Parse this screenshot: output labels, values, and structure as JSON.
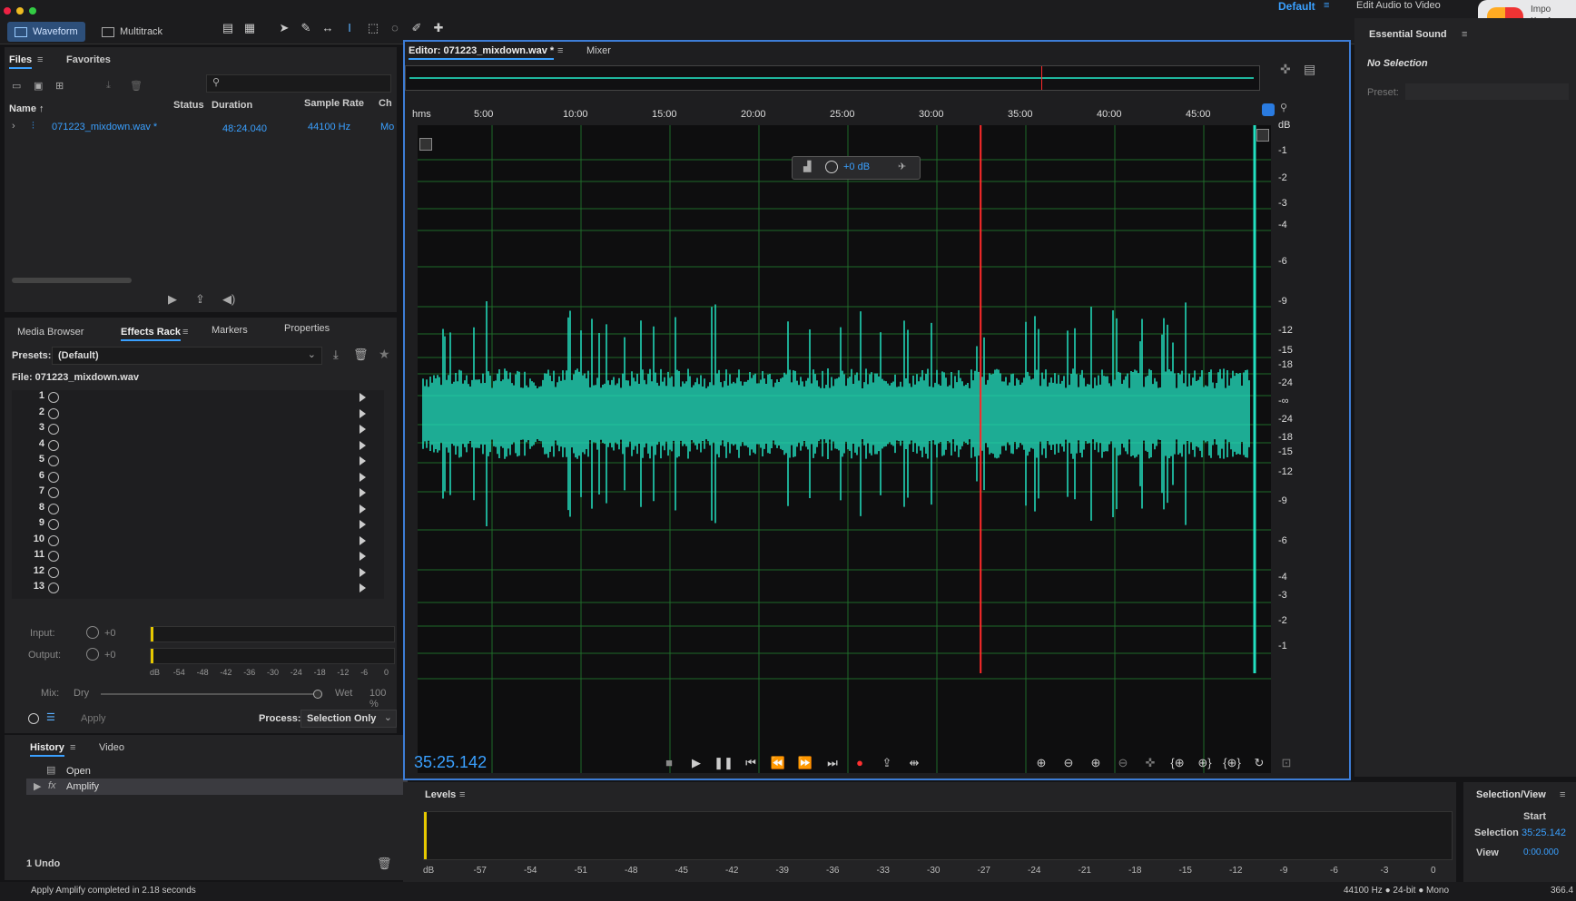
{
  "workspace": {
    "name": "Default",
    "edit_audio_label": "Edit Audio to Video",
    "notif_text": "Impo KeyAc KeyAc you a"
  },
  "tabs": {
    "waveform": "Waveform",
    "multitrack": "Multitrack"
  },
  "files_panel": {
    "tabs": [
      "Files",
      "Favorites"
    ],
    "columns": {
      "name": "Name",
      "status": "Status",
      "duration": "Duration",
      "sample_rate": "Sample Rate",
      "channels": "Ch"
    },
    "files": [
      {
        "name": "071223_mixdown.wav *",
        "duration": "48:24.040",
        "sample_rate": "44100 Hz",
        "channels": "Mo"
      }
    ]
  },
  "effects_panel": {
    "tabs": [
      "Media Browser",
      "Effects Rack",
      "Markers",
      "Properties"
    ],
    "presets_label": "Presets:",
    "preset_value": "(Default)",
    "file_label": "File: 071223_mixdown.wav",
    "slots": [
      "1",
      "2",
      "3",
      "4",
      "5",
      "6",
      "7",
      "8",
      "9",
      "10",
      "11",
      "12",
      "13"
    ],
    "input_label": "Input:",
    "input_value": "+0",
    "output_label": "Output:",
    "output_value": "+0",
    "meter_ticks": [
      "dB",
      "-54",
      "-48",
      "-42",
      "-36",
      "-30",
      "-24",
      "-18",
      "-12",
      "-6",
      "0"
    ],
    "mix_label": "Mix:",
    "dry_label": "Dry",
    "wet_label": "Wet",
    "wet_value": "100 %",
    "apply_label": "Apply",
    "process_label": "Process:",
    "process_value": "Selection Only"
  },
  "history_panel": {
    "tabs": [
      "History",
      "Video"
    ],
    "items": [
      "Open",
      "Amplify"
    ],
    "undo_label": "1 Undo"
  },
  "status_message": "Apply Amplify completed in 2.18 seconds",
  "editor": {
    "tab_label": "Editor: 071223_mixdown.wav *",
    "mixer_label": "Mixer",
    "ruler_unit": "hms",
    "ruler_ticks": [
      "5:00",
      "10:00",
      "15:00",
      "20:00",
      "25:00",
      "30:00",
      "35:00",
      "40:00",
      "45:00"
    ],
    "db_unit": "dB",
    "db_ticks_top": [
      "-1",
      "-2",
      "-3",
      "-4",
      "-6",
      "-9",
      "-12",
      "-15",
      "-18",
      "-24",
      "-∞"
    ],
    "db_ticks_bottom": [
      "-24",
      "-18",
      "-15",
      "-12",
      "-9",
      "-6",
      "-4",
      "-3",
      "-2",
      "-1"
    ],
    "hud_value": "+0 dB",
    "current_time": "35:25.142",
    "playhead_fraction": 0.73,
    "waveform_color": "#22e0c0",
    "playhead_color": "#ff2a2a"
  },
  "levels_panel": {
    "title": "Levels",
    "ticks": [
      "dB",
      "-57",
      "-54",
      "-51",
      "-48",
      "-45",
      "-42",
      "-39",
      "-36",
      "-33",
      "-30",
      "-27",
      "-24",
      "-21",
      "-18",
      "-15",
      "-12",
      "-9",
      "-6",
      "-3",
      "0"
    ]
  },
  "essential_sound": {
    "title": "Essential Sound",
    "no_selection": "No Selection",
    "preset_label": "Preset:"
  },
  "selection_view": {
    "title": "Selection/View",
    "start_label": "Start",
    "selection_label": "Selection",
    "selection_value": "35:25.142",
    "view_label": "View",
    "view_value": "0:00.000"
  },
  "format_info": "44100 Hz ● 24-bit ● Mono",
  "format_extra": "366.4"
}
